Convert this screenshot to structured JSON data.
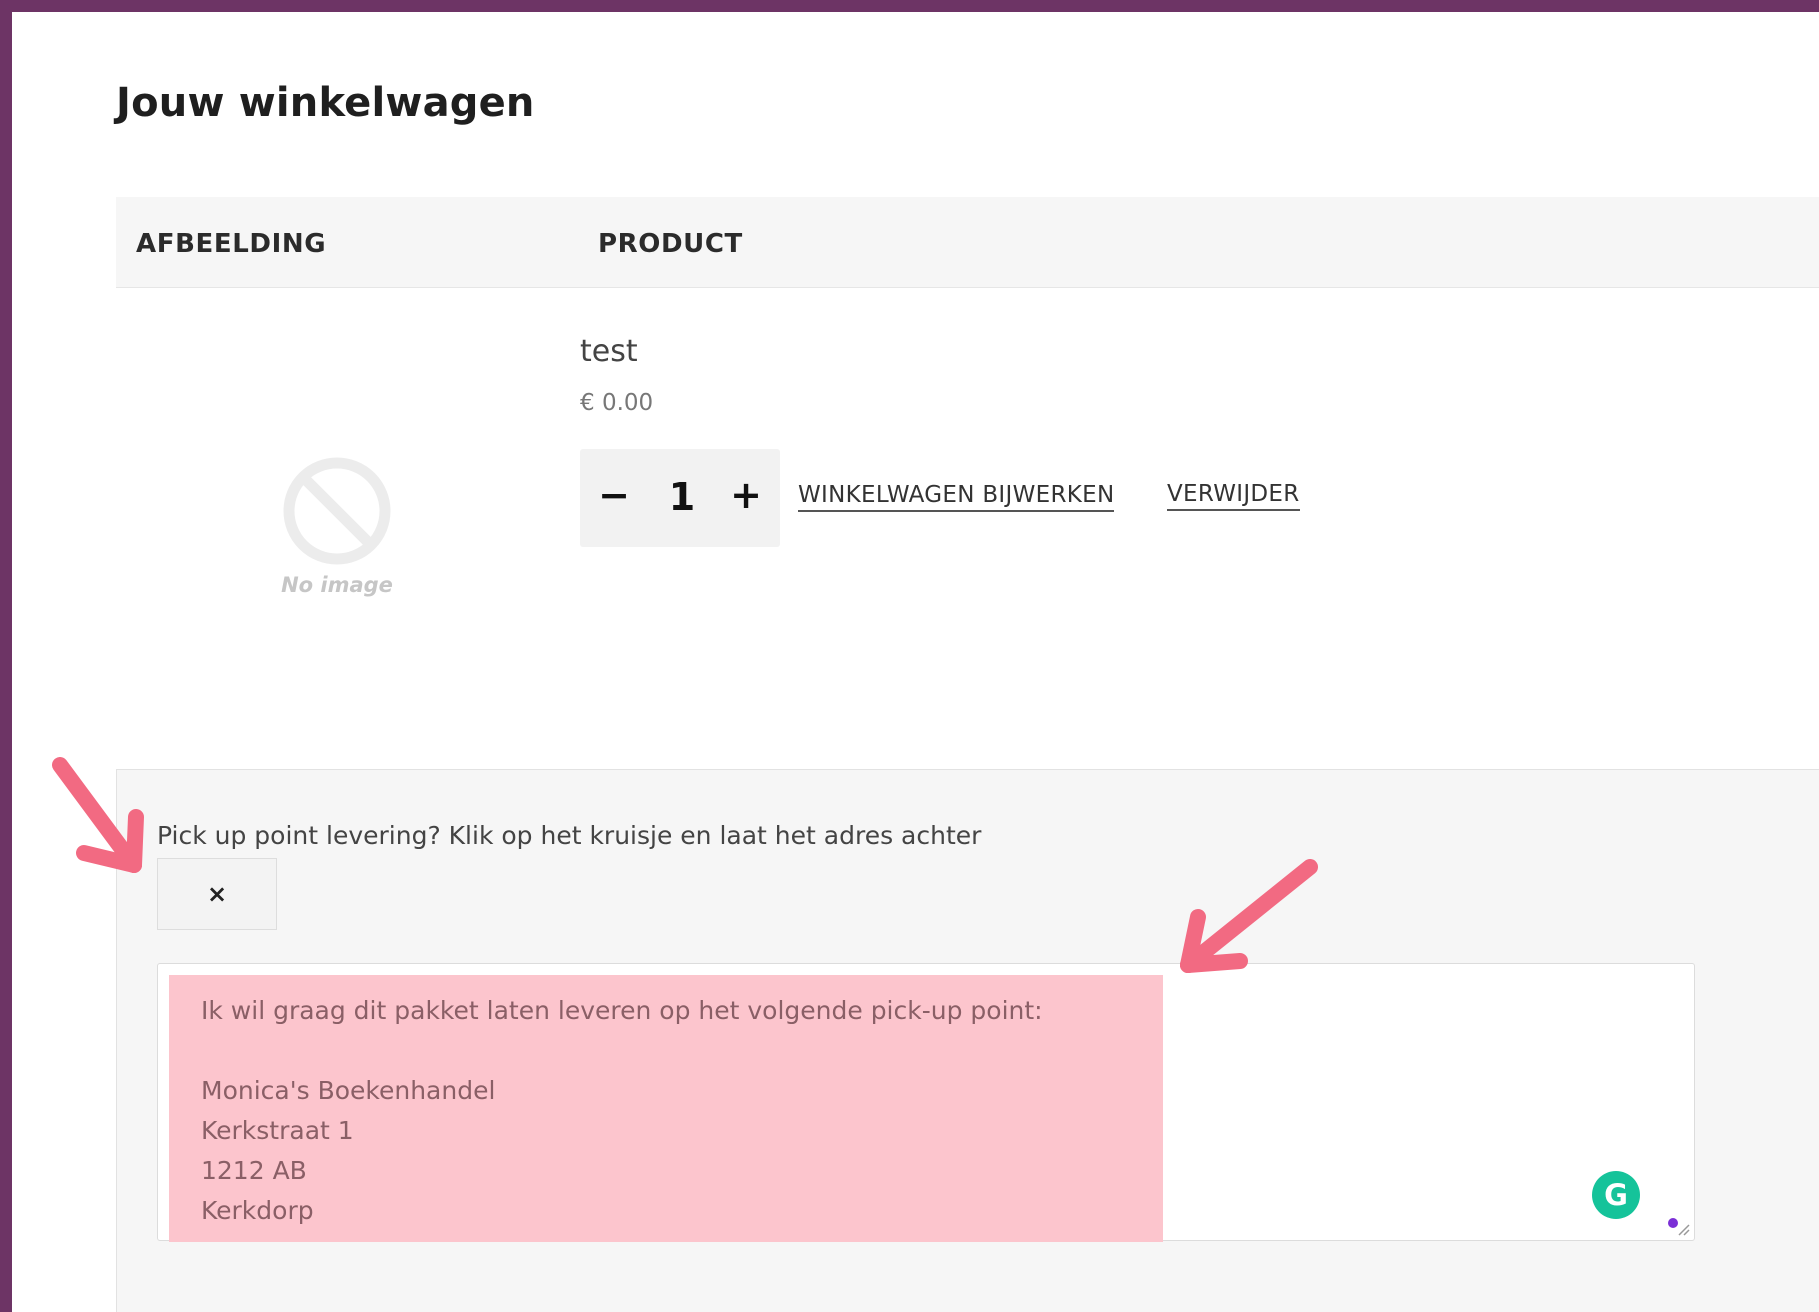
{
  "page": {
    "title": "Jouw winkelwagen"
  },
  "cart_table": {
    "headers": {
      "image": "AFBEELDING",
      "product": "PRODUCT"
    }
  },
  "item": {
    "image_placeholder": "No image",
    "name": "test",
    "price": "€ 0.00",
    "quantity": "1",
    "minus_label": "−",
    "plus_label": "+",
    "update_label": "WINKELWAGEN BIJWERKEN",
    "remove_label": "VERWIJDER"
  },
  "pickup": {
    "question": "Pick up point levering? Klik op het kruisje en laat het adres achter",
    "toggle_label": "×",
    "address_text": "Ik wil graag dit pakket laten leveren op het volgende pick-up point:\n\nMonica's Boekenhandel\nKerkstraat 1\n1212 AB\nKerkdorp",
    "grammarly_label": "G"
  },
  "colors": {
    "outer_frame": "#6d3465",
    "highlight": "#fcc5cd",
    "arrow": "#f26a82",
    "grammarly": "#15c39a"
  },
  "icons": {
    "no_image": "prohibited-circle-icon",
    "arrows": "annotation-arrow-icon"
  }
}
